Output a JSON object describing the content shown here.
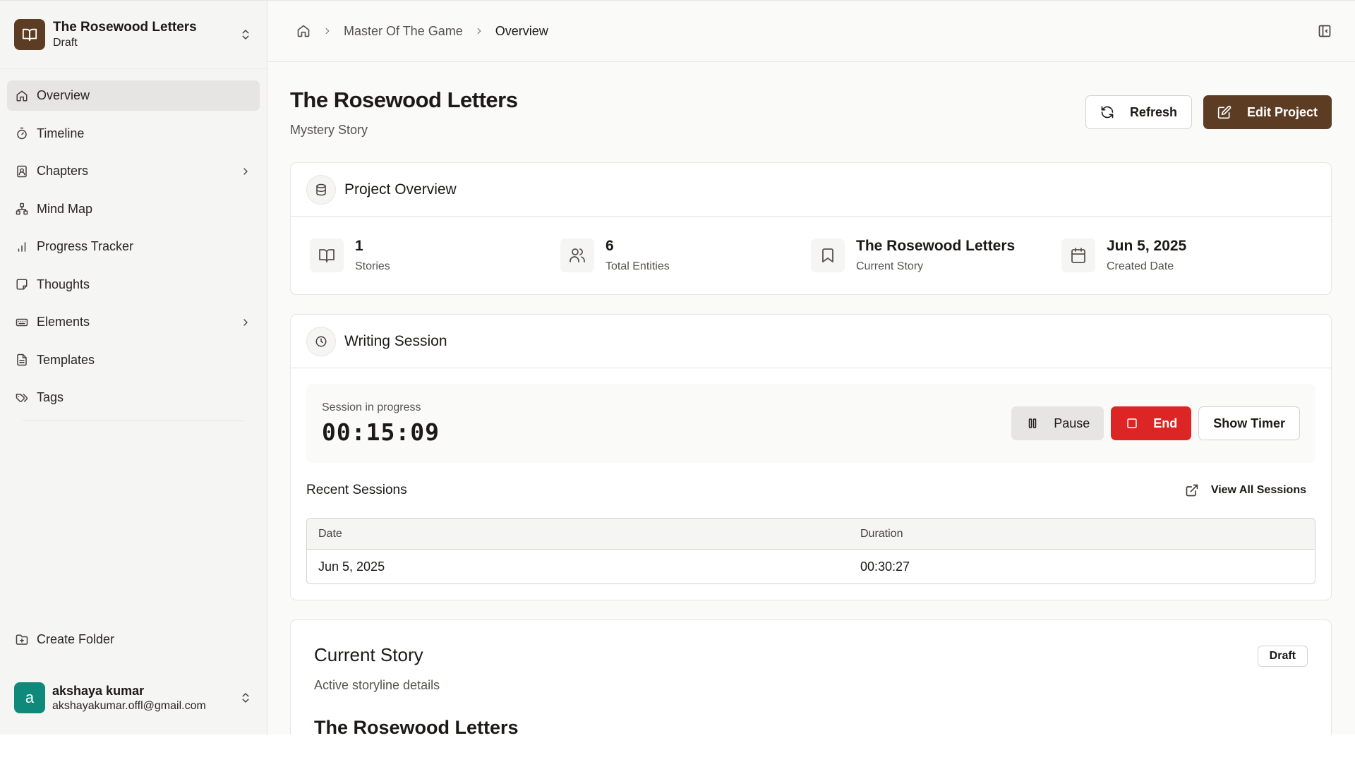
{
  "project": {
    "title": "The Rosewood Letters",
    "status": "Draft"
  },
  "nav": {
    "items": [
      {
        "label": "Overview"
      },
      {
        "label": "Timeline"
      },
      {
        "label": "Chapters"
      },
      {
        "label": "Mind Map"
      },
      {
        "label": "Progress Tracker"
      },
      {
        "label": "Thoughts"
      },
      {
        "label": "Elements"
      },
      {
        "label": "Templates"
      },
      {
        "label": "Tags"
      }
    ],
    "create_folder": "Create Folder"
  },
  "user": {
    "initial": "a",
    "name": "akshaya kumar",
    "email": "akshayakumar.offl@gmail.com"
  },
  "breadcrumb": {
    "parent": "Master Of The Game",
    "current": "Overview"
  },
  "header": {
    "title": "The Rosewood Letters",
    "subtitle": "Mystery Story",
    "refresh_label": "Refresh",
    "edit_label": "Edit Project"
  },
  "overview": {
    "title": "Project Overview",
    "stats": [
      {
        "value": "1",
        "label": "Stories"
      },
      {
        "value": "6",
        "label": "Total Entities"
      },
      {
        "value": "The Rosewood Letters",
        "label": "Current Story"
      },
      {
        "value": "Jun 5, 2025",
        "label": "Created Date"
      }
    ]
  },
  "session": {
    "title": "Writing Session",
    "status_label": "Session in progress",
    "timer": "00:15:09",
    "pause_label": "Pause",
    "end_label": "End",
    "show_timer_label": "Show Timer",
    "recent_title": "Recent Sessions",
    "view_all_label": "View All Sessions",
    "columns": [
      "Date",
      "Duration"
    ],
    "rows": [
      {
        "date": "Jun 5, 2025",
        "duration": "00:30:27"
      }
    ]
  },
  "current_story": {
    "title": "Current Story",
    "badge": "Draft",
    "subtitle": "Active storyline details",
    "name": "The Rosewood Letters"
  },
  "colors": {
    "accent": "#5c3d24",
    "danger": "#dc2626",
    "avatar": "#0f8a7a"
  }
}
